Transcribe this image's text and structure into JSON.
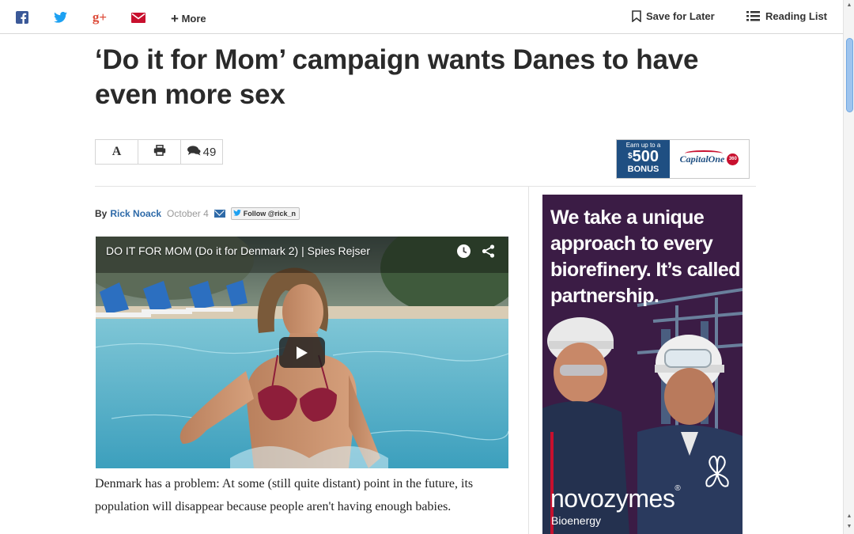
{
  "topbar": {
    "share_icons": [
      "facebook-icon",
      "twitter-icon",
      "google-plus-icon",
      "email-icon"
    ],
    "more_label": "More",
    "save_label": "Save for Later",
    "reading_list_label": "Reading List"
  },
  "article": {
    "headline": "‘Do it for Mom’ campaign wants Danes to have even more sex",
    "tools": {
      "font_label": "A",
      "comment_count": "49"
    },
    "byline": {
      "by": "By",
      "author": "Rick Noack",
      "date": "October 4",
      "follow_label": "Follow @rick_n"
    },
    "video": {
      "title": "DO IT FOR MOM (Do it for Denmark 2) | Spies Rejser"
    },
    "body": "Denmark has a problem: At some (still quite distant) point in the future, its population will disappear because people aren't having enough babies."
  },
  "ad_small": {
    "earn": "Earn up to a",
    "currency": "$",
    "amount": "500",
    "bonus": "BONUS",
    "brand": "CapitalOne",
    "badge": "360"
  },
  "ad_big": {
    "headline": "We take a unique approach to every biorefinery. It’s called partnership.",
    "brand": "novozymes",
    "registered": "®",
    "sub": "Bioenergy"
  },
  "colors": {
    "link_blue": "#2e6aa8",
    "facebook": "#3b5998",
    "twitter": "#1da1f2",
    "google_plus": "#dd4b39",
    "email": "#c8102e",
    "ad_purple": "#3a1a40"
  }
}
